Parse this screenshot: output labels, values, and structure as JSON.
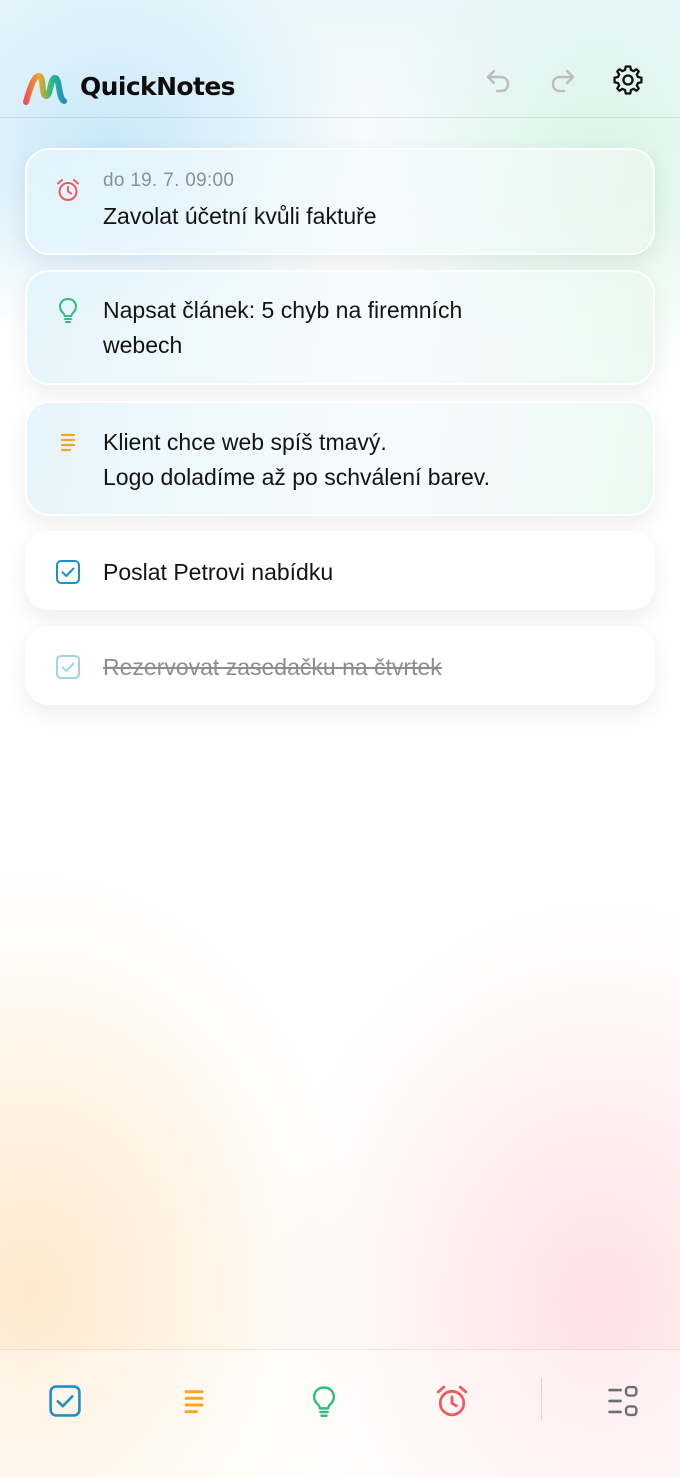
{
  "header": {
    "title": "QuickNotes",
    "logo_icon": "rainbow-m-logo",
    "undo_icon": "undo-arrow-icon",
    "redo_icon": "redo-arrow-icon",
    "settings_icon": "gear-icon"
  },
  "notes": [
    {
      "type": "reminder",
      "icon": "alarm-clock-icon",
      "color": "#ef5b5b",
      "meta": "do 19. 7. 09:00",
      "text": "Zavolat účetní kvůli faktuře",
      "done": false
    },
    {
      "type": "idea",
      "icon": "lightbulb-icon",
      "color": "#2ebd7f",
      "text": "Napsat článek: 5 chyb na firemních\nwebech",
      "done": false
    },
    {
      "type": "note",
      "icon": "lines-icon",
      "color": "#f5a623",
      "text": "Klient chce web spíš tmavý.\nLogo doladíme až po schválení barev.",
      "done": false
    },
    {
      "type": "task",
      "icon": "checkbox-checked-icon",
      "color": "#1d8fc9",
      "text": "Poslat Petrovi nabídku",
      "done": false
    },
    {
      "type": "task",
      "icon": "checkbox-checked-icon",
      "color": "#9fd3ea",
      "text": "Rezervovat zasedačku na čtvrtek",
      "done": true
    }
  ],
  "bottom_nav": [
    {
      "name": "tasks",
      "icon": "checkbox-checked-icon",
      "color": "#1d8fc9"
    },
    {
      "name": "notes",
      "icon": "lines-icon",
      "color": "#f5a623"
    },
    {
      "name": "ideas",
      "icon": "lightbulb-icon",
      "color": "#2ebd7f"
    },
    {
      "name": "reminders",
      "icon": "alarm-clock-icon",
      "color": "#ef5b5b"
    },
    {
      "name": "filter",
      "icon": "list-grid-icon",
      "color": "#6b6f73"
    }
  ]
}
